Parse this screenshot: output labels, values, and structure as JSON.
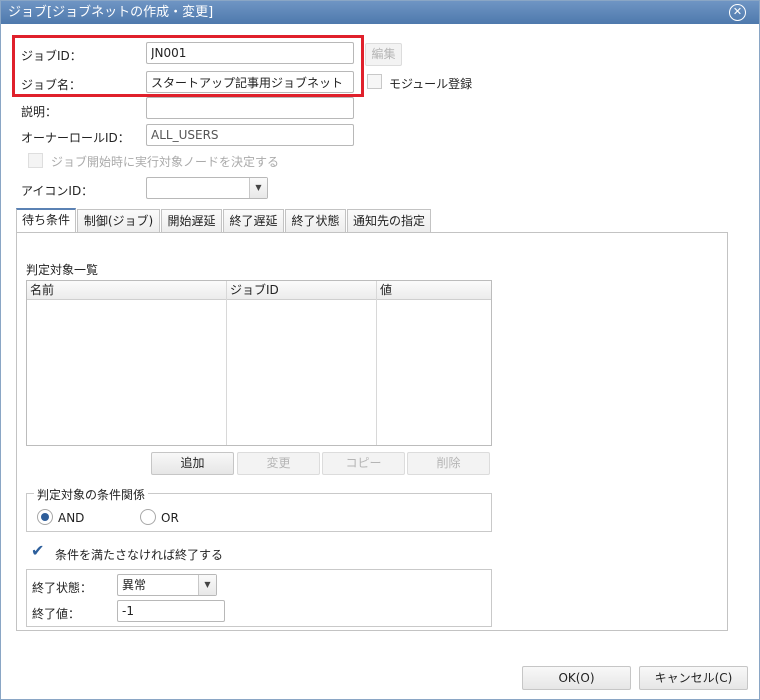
{
  "window": {
    "title": "ジョブ[ジョブネットの作成・変更]"
  },
  "form": {
    "job_id_label": "ジョブID：",
    "job_id_value": "JN001",
    "edit_button": "編集",
    "job_name_label": "ジョブ名：",
    "job_name_value": "スタートアップ記事用ジョブネット",
    "module_register_label": "モジュール登録",
    "description_label": "説明：",
    "description_value": "",
    "owner_role_label": "オーナーロールID：",
    "owner_role_value": "ALL_USERS",
    "decide_node_label": "ジョブ開始時に実行対象ノードを決定する",
    "icon_id_label": "アイコンID：",
    "icon_id_value": ""
  },
  "tabs": [
    {
      "label": "待ち条件"
    },
    {
      "label": "制御(ジョブ)"
    },
    {
      "label": "開始遅延"
    },
    {
      "label": "終了遅延"
    },
    {
      "label": "終了状態"
    },
    {
      "label": "通知先の指定"
    }
  ],
  "wait": {
    "list_title": "判定対象一覧",
    "columns": [
      "名前",
      "ジョブID",
      "値"
    ],
    "rows": [],
    "add_button": "追加",
    "change_button": "変更",
    "copy_button": "コピー",
    "delete_button": "削除",
    "relation_legend": "判定対象の条件関係",
    "and_label": "AND",
    "or_label": "OR",
    "end_if_unmet_label": "条件を満たさなければ終了する",
    "end_status_label": "終了状態：",
    "end_status_value": "異常",
    "end_value_label": "終了値：",
    "end_value_value": "-1"
  },
  "footer": {
    "ok_button": "OK(O)",
    "cancel_button": "キャンセル(C)"
  }
}
